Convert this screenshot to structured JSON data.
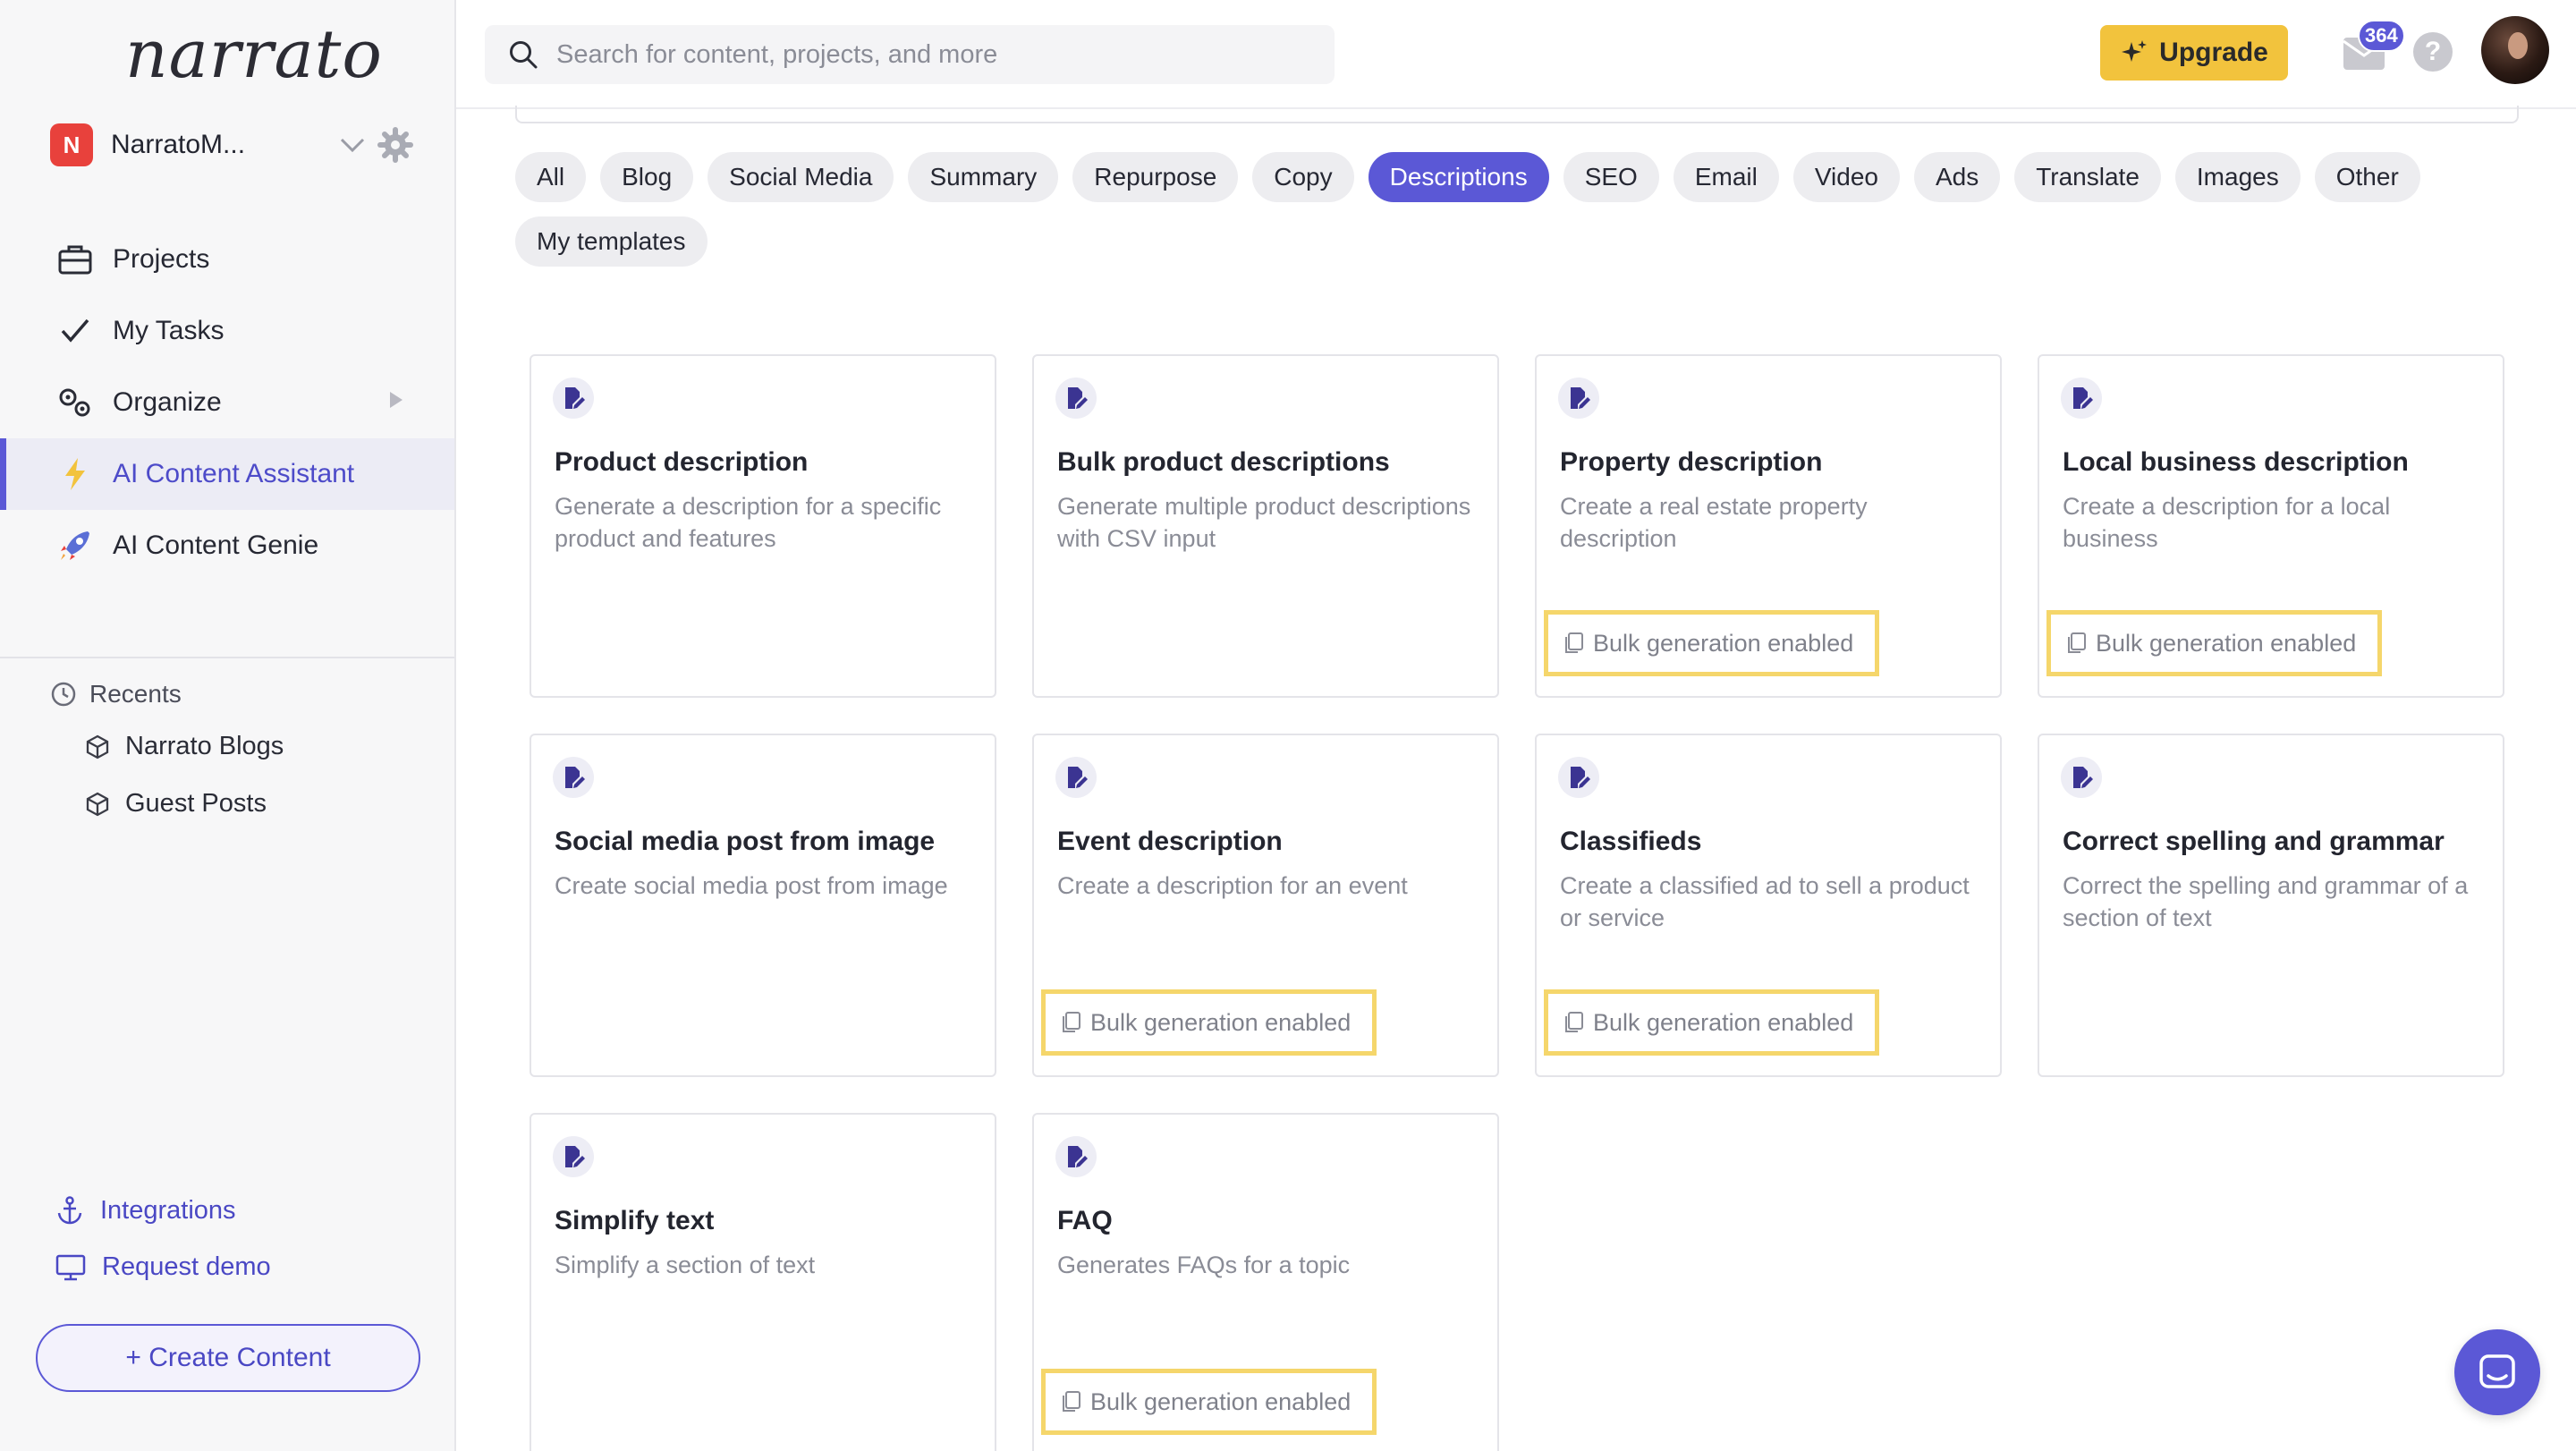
{
  "brand": {
    "logo_text": "narrato"
  },
  "workspace": {
    "badge": "N",
    "name": "NarratoM..."
  },
  "nav": [
    {
      "label": "Projects"
    },
    {
      "label": "My Tasks"
    },
    {
      "label": "Organize"
    },
    {
      "label": "AI Content Assistant",
      "active": true
    },
    {
      "label": "AI Content Genie"
    }
  ],
  "recents": {
    "title": "Recents",
    "items": [
      {
        "label": "Narrato Blogs"
      },
      {
        "label": "Guest Posts"
      }
    ]
  },
  "bottom_links": {
    "integrations": "Integrations",
    "request_demo": "Request demo"
  },
  "create_button": "+ Create Content",
  "header": {
    "search_placeholder": "Search for content, projects, and more",
    "upgrade_label": "Upgrade",
    "mail_count": "364",
    "help_label": "?"
  },
  "filters": {
    "items": [
      "All",
      "Blog",
      "Social Media",
      "Summary",
      "Repurpose",
      "Copy",
      "Descriptions",
      "SEO",
      "Email",
      "Video",
      "Ads",
      "Translate",
      "Images",
      "Other",
      "My templates"
    ],
    "active": "Descriptions"
  },
  "templates": [
    {
      "title": "Product description",
      "desc": "Generate a description for a specific product and features",
      "bulk": ""
    },
    {
      "title": "Bulk product descriptions",
      "desc": "Generate multiple product descriptions with CSV input",
      "bulk": ""
    },
    {
      "title": "Property description",
      "desc": "Create a real estate property description",
      "bulk": "Bulk generation enabled"
    },
    {
      "title": "Local business description",
      "desc": "Create a description for a local business",
      "bulk": "Bulk generation enabled"
    },
    {
      "title": "Social media post from image",
      "desc": "Create social media post from image",
      "bulk": ""
    },
    {
      "title": "Event description",
      "desc": "Create a description for an event",
      "bulk": "Bulk generation enabled"
    },
    {
      "title": "Classifieds",
      "desc": "Create a classified ad to sell a product or service",
      "bulk": "Bulk generation enabled"
    },
    {
      "title": "Correct spelling and grammar",
      "desc": "Correct the spelling and grammar of a section of text",
      "bulk": ""
    },
    {
      "title": "Simplify text",
      "desc": "Simplify a section of text",
      "bulk": ""
    },
    {
      "title": "FAQ",
      "desc": "Generates FAQs for a topic",
      "bulk": "Bulk generation enabled"
    }
  ],
  "colors": {
    "accent": "#5b58d6",
    "upgrade": "#f2c33d",
    "highlight": "#f5d66b",
    "workspace_badge": "#e8413c"
  }
}
